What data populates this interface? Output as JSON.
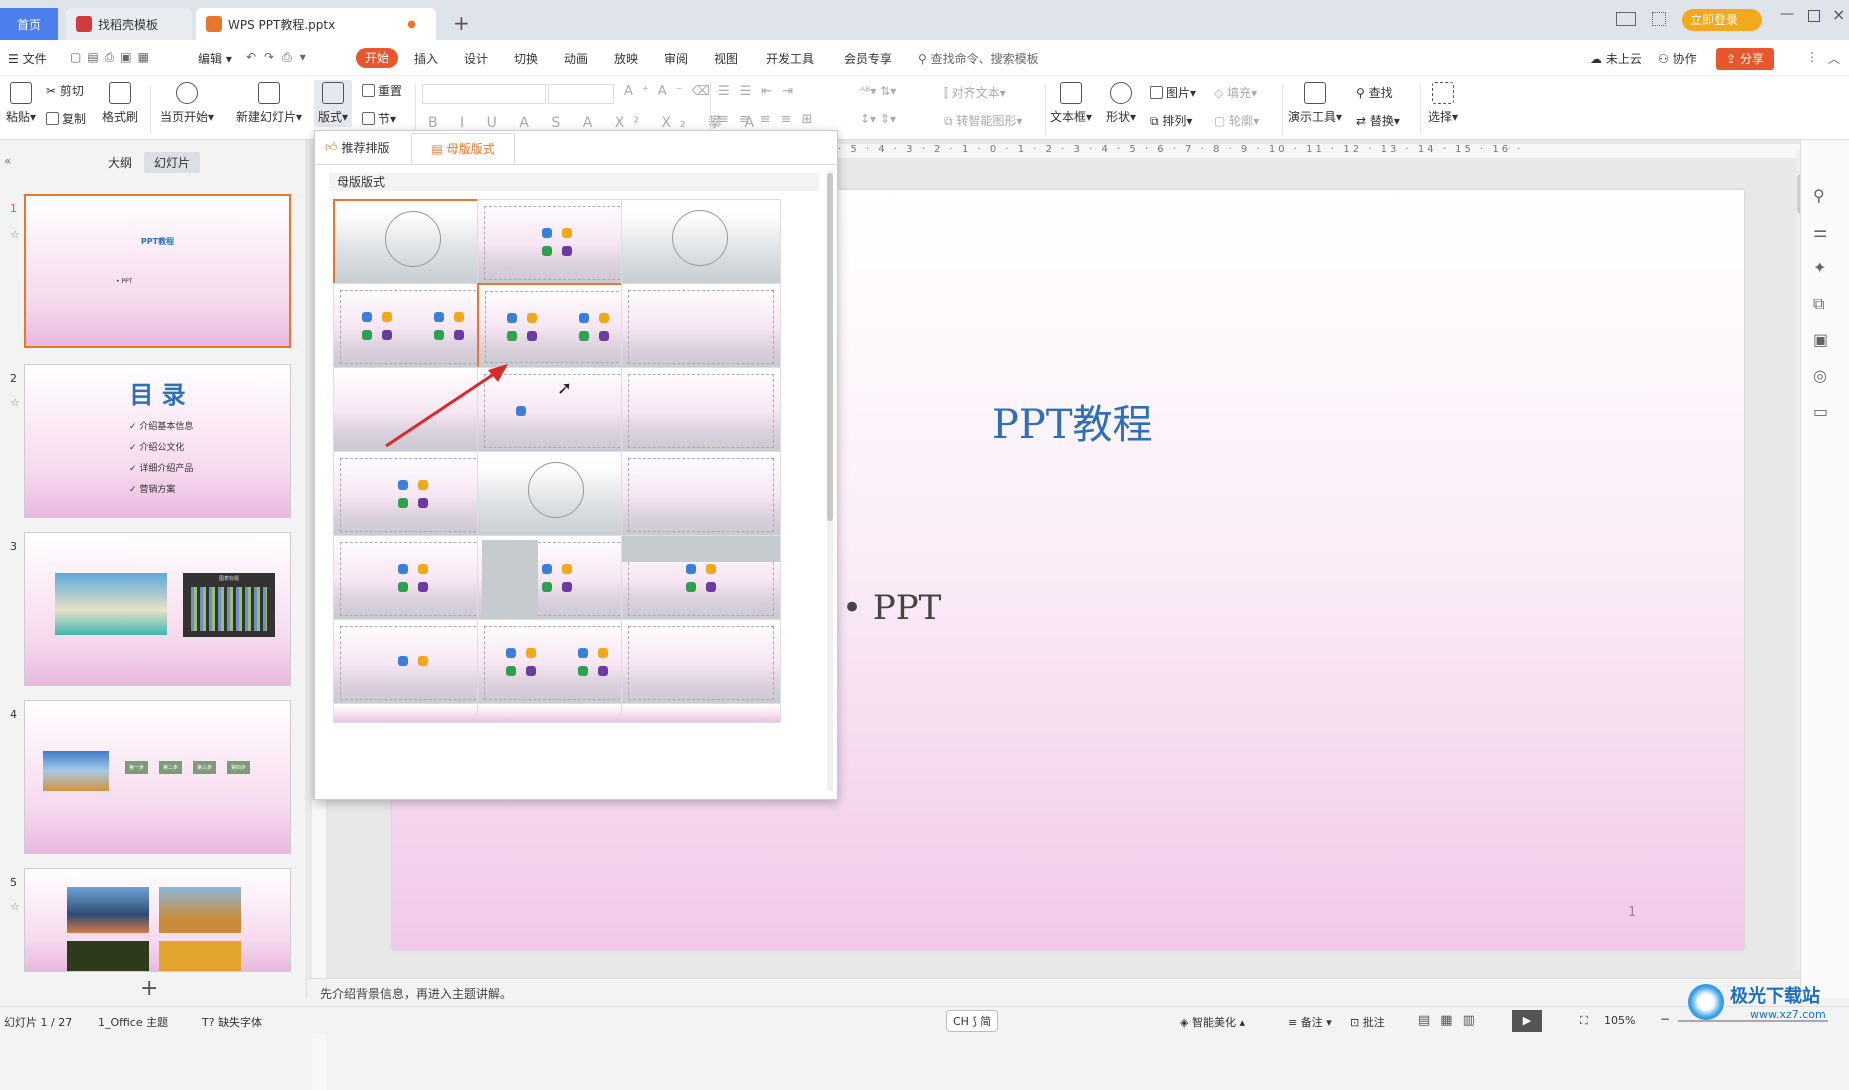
{
  "tabs": {
    "home": "首页",
    "templates": "找稻壳模板",
    "document": "WPS PPT教程.pptx",
    "login": "立即登录"
  },
  "menu": {
    "file": "文件",
    "edit": "编辑",
    "items": [
      "开始",
      "插入",
      "设计",
      "切换",
      "动画",
      "放映",
      "审阅",
      "视图",
      "开发工具",
      "会员专享"
    ],
    "search": "查找命令、搜索模板",
    "cloud": "未上云",
    "collab": "协作",
    "share": "分享"
  },
  "ribbon": {
    "paste": "粘贴",
    "cut": "剪切",
    "copy": "复制",
    "format_painter": "格式刷",
    "play_from_current": "当页开始",
    "new_slide": "新建幻灯片",
    "layout": "版式",
    "reset": "重置",
    "section": "节",
    "align_text": "对齐文本",
    "convert_smart": "转智能图形",
    "textbox": "文本框",
    "shape": "形状",
    "picture": "图片",
    "arrange": "排列",
    "fill": "填充",
    "outline": "轮廓",
    "presentation_tools": "演示工具",
    "find": "查找",
    "replace": "替换",
    "select": "选择"
  },
  "left_panel": {
    "tab_outline": "大纲",
    "tab_slides": "幻灯片",
    "slides": [
      {
        "num": "1",
        "title": "PPT教程",
        "bullet": "• PPT"
      },
      {
        "num": "2",
        "title": "目 录",
        "items": [
          "介绍基本信息",
          "介绍公文化",
          "详细介绍产品",
          "营销方案"
        ]
      },
      {
        "num": "3",
        "chart_title": "图表标题"
      },
      {
        "num": "4",
        "steps": [
          "第一步",
          "第二步",
          "第三步",
          "第四步"
        ]
      },
      {
        "num": "5"
      }
    ],
    "add": "+"
  },
  "popup": {
    "tab_recommended": "推荐排版",
    "tab_master": "母版版式",
    "section": "母版版式"
  },
  "slide": {
    "title": "PPT教程",
    "bullet": "PPT",
    "page": "1"
  },
  "notes": "先介绍背景信息，再进入主题讲解。",
  "status": {
    "slide_count": "幻灯片 1 / 27",
    "theme": "1_Office 主题",
    "missing_font": "缺失字体",
    "ime": "CH ⟆ 简",
    "beautify": "智能美化",
    "notes": "备注",
    "comments": "批注",
    "zoom": "105%"
  },
  "watermark": {
    "name": "极光下载站",
    "url": "www.xz7.com"
  },
  "colors": {
    "accent_orange": "#e8762d",
    "home_blue": "#4d7fee",
    "title_blue": "#2e6fb7",
    "share_red": "#e8562d"
  }
}
